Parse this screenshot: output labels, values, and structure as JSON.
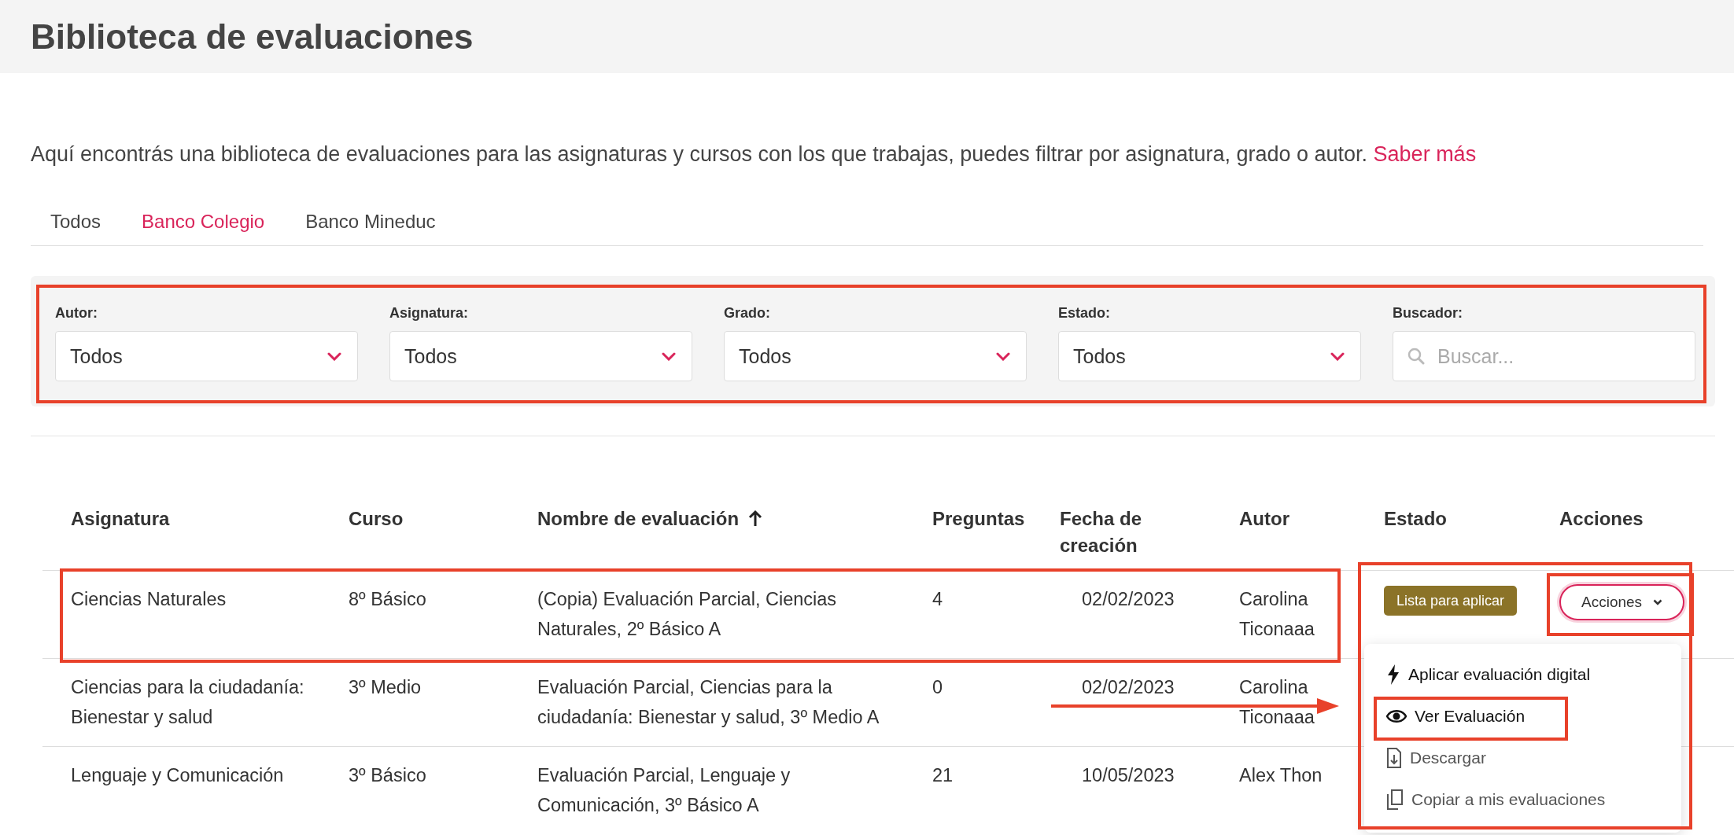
{
  "page_title": "Biblioteca de evaluaciones",
  "intro": {
    "text": "Aquí encontrás una biblioteca de evaluaciones para las asignaturas y cursos con los que trabajas, puedes filtrar por asignatura, grado o autor.",
    "link": "Saber más"
  },
  "tabs": [
    {
      "label": "Todos",
      "selected": false
    },
    {
      "label": "Banco Colegio",
      "selected": true
    },
    {
      "label": "Banco Mineduc",
      "selected": false
    }
  ],
  "filters": [
    {
      "label": "Autor:",
      "kind": "select",
      "value": "Todos"
    },
    {
      "label": "Asignatura:",
      "kind": "select",
      "value": "Todos"
    },
    {
      "label": "Grado:",
      "kind": "select",
      "value": "Todos"
    },
    {
      "label": "Estado:",
      "kind": "select",
      "value": "Todos"
    },
    {
      "label": "Buscador:",
      "kind": "search",
      "placeholder": "Buscar..."
    }
  ],
  "table": {
    "columns": [
      {
        "label": "Asignatura",
        "sorted": false
      },
      {
        "label": "Curso",
        "sorted": false
      },
      {
        "label": "Nombre de evaluación",
        "sorted": true
      },
      {
        "label": "Preguntas",
        "sorted": false
      },
      {
        "label": "Fecha de creación",
        "sorted": false
      },
      {
        "label": "Autor",
        "sorted": false
      },
      {
        "label": "Estado",
        "sorted": false
      },
      {
        "label": "Acciones",
        "sorted": false
      }
    ],
    "rows": [
      {
        "asignatura": "Ciencias Naturales",
        "curso": "8º Básico",
        "nombre": "(Copia) Evaluación Parcial, Ciencias Naturales, 2º Básico A",
        "preguntas": "4",
        "fecha": "02/02/2023",
        "autor": "Carolina Ticonaaa",
        "estado": "Lista para aplicar",
        "acciones": "Acciones",
        "menu_open": true,
        "highlighted": true
      },
      {
        "asignatura": "Ciencias para la ciudadanía: Bienestar y salud",
        "curso": "3º Medio",
        "nombre": "Evaluación Parcial, Ciencias para la ciudadanía: Bienestar y salud, 3º Medio A",
        "preguntas": "0",
        "fecha": "02/02/2023",
        "autor": "Carolina Ticonaaa",
        "menu_open": false,
        "highlighted": false
      },
      {
        "asignatura": "Lenguaje y Comunicación",
        "curso": "3º Básico",
        "nombre": "Evaluación Parcial, Lenguaje y Comunicación, 3º Básico A",
        "preguntas": "21",
        "fecha": "10/05/2023",
        "autor": "Alex Thon",
        "menu_open": false,
        "highlighted": false
      }
    ]
  },
  "actions_menu": [
    {
      "label": "Aplicar evaluación digital",
      "kind": "bolt",
      "enabled": true,
      "highlighted": false
    },
    {
      "label": "Ver Evaluación",
      "kind": "eye",
      "enabled": true,
      "highlighted": true
    },
    {
      "label": "Descargar",
      "kind": "download",
      "enabled": false,
      "highlighted": false
    },
    {
      "label": "Copiar a mis evaluaciones",
      "kind": "copy",
      "enabled": false,
      "highlighted": false
    }
  ]
}
